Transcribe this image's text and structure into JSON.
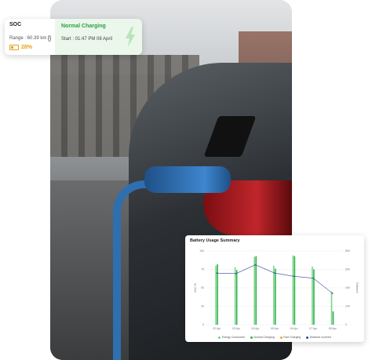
{
  "soc_card": {
    "title": "SOC",
    "range_label": "Range : 60.39 km",
    "percentage": "28%",
    "status_title": "Normal Charging",
    "start_label": "Start : 01:47 PM 08 April",
    "colors": {
      "status": "#2f9e44",
      "battery": "#e6a11c",
      "status_bg": "#eaf7ea"
    },
    "icons": [
      "info-icon",
      "battery-icon",
      "lightning-bolt-icon"
    ]
  },
  "usage_card": {
    "title": "Battery Usage Summary"
  },
  "chart_data": {
    "type": "bar",
    "title": "Battery Usage Summary",
    "categories": [
      "02 Apr",
      "03 Apr",
      "04 Apr",
      "05 Apr",
      "06 Apr",
      "07 Apr",
      "08 Apr"
    ],
    "xlabel": "",
    "ylabel": "SOC %",
    "y2label": "Distance",
    "ylim": [
      0,
      100
    ],
    "yticks": [
      0,
      25,
      50,
      75,
      100
    ],
    "y2lim": [
      0,
      800
    ],
    "y2ticks": [
      0,
      200,
      400,
      600,
      800
    ],
    "series": [
      {
        "name": "Energy Consumed",
        "type": "bar",
        "color": "#7dd38a",
        "values": [
          80,
          78,
          92,
          80,
          94,
          79,
          45
        ]
      },
      {
        "name": "Normal Charging",
        "type": "bar",
        "color": "#2fb34a",
        "values": [
          82,
          74,
          93,
          76,
          93,
          75,
          18
        ]
      },
      {
        "name": "Fast Charging",
        "type": "bar",
        "color": "#f3a531",
        "values": [
          0,
          0,
          0,
          0,
          0,
          0,
          0
        ]
      },
      {
        "name": "Distance covered",
        "type": "line",
        "axis": "right",
        "color": "#2b4c9a",
        "values": [
          560,
          555,
          650,
          560,
          525,
          505,
          340
        ]
      }
    ],
    "legend_position": "bottom",
    "grid": true
  }
}
